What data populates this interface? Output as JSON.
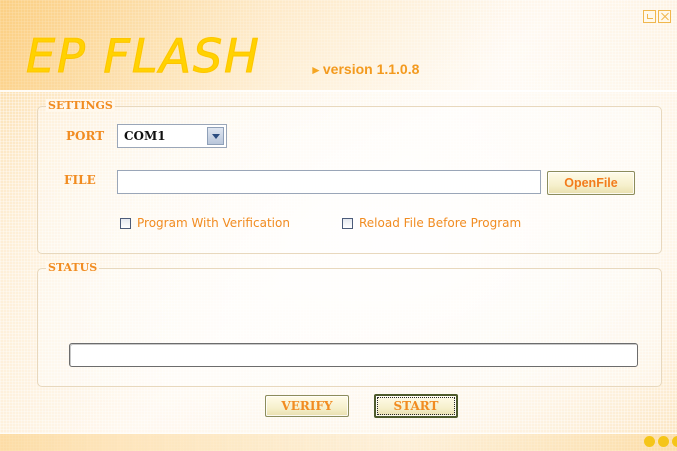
{
  "app": {
    "logo_text": "EP FLASH",
    "version_text": "version 1.1.0.8",
    "brand_color": "#ffd200",
    "accent_color": "#f18c21"
  },
  "window_controls": {
    "minimize_icon": "minimize-icon",
    "close_icon": "close-icon"
  },
  "settings": {
    "title": "SETTINGS",
    "port_label": "PORT",
    "port_value": "COM1",
    "file_label": "FILE",
    "file_value": "",
    "open_file_label": "OpenFile",
    "program_with_verification_label": "Program With Verification",
    "program_with_verification_checked": false,
    "reload_file_label": "Reload File Before Program",
    "reload_file_checked": false
  },
  "status": {
    "title": "STATUS",
    "progress_percent": 0
  },
  "actions": {
    "verify_label": "VERIFY",
    "start_label": "START"
  }
}
